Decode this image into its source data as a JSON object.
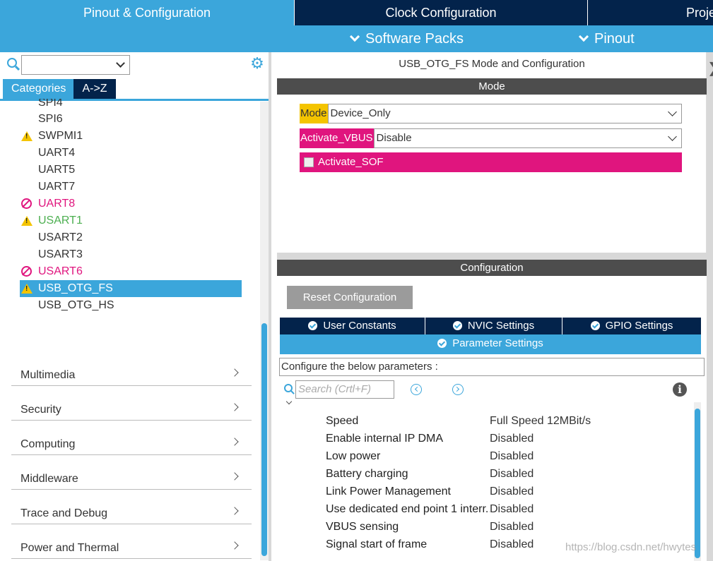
{
  "top_tabs": {
    "pinout_config": "Pinout & Configuration",
    "clock_config": "Clock Configuration",
    "project": "Proje"
  },
  "sub_menu": {
    "software_packs": "Software Packs",
    "pinout": "Pinout"
  },
  "left": {
    "search_value": "",
    "tab_categories": "Categories",
    "tab_az": "A->Z",
    "peripherals": [
      {
        "label": "SPI4",
        "status": "none"
      },
      {
        "label": "SPI6",
        "status": "none"
      },
      {
        "label": "SWPMI1",
        "status": "warning"
      },
      {
        "label": "UART4",
        "status": "none"
      },
      {
        "label": "UART5",
        "status": "none"
      },
      {
        "label": "UART7",
        "status": "none"
      },
      {
        "label": "UART8",
        "status": "disabled"
      },
      {
        "label": "USART1",
        "status": "warning-active"
      },
      {
        "label": "USART2",
        "status": "none"
      },
      {
        "label": "USART3",
        "status": "none"
      },
      {
        "label": "USART6",
        "status": "disabled"
      },
      {
        "label": "USB_OTG_FS",
        "status": "warning-selected"
      },
      {
        "label": "USB_OTG_HS",
        "status": "none"
      }
    ],
    "categories": [
      "Multimedia",
      "Security",
      "Computing",
      "Middleware",
      "Trace and Debug",
      "Power and Thermal"
    ]
  },
  "mode_panel": {
    "title": "USB_OTG_FS Mode and Configuration",
    "section": "Mode",
    "mode_label": "Mode",
    "mode_value": "Device_Only",
    "vbus_label": "Activate_VBUS",
    "vbus_value": "Disable",
    "sof_label": "Activate_SOF"
  },
  "config_panel": {
    "section": "Configuration",
    "reset_button": "Reset Configuration",
    "tabs": [
      "User Constants",
      "NVIC Settings",
      "GPIO Settings"
    ],
    "active_tab": "Parameter Settings",
    "configure_text": "Configure the below parameters :",
    "search_placeholder": "Search (Crtl+F)",
    "params": [
      {
        "name": "Speed",
        "value": "Full Speed 12MBit/s"
      },
      {
        "name": "Enable internal IP DMA",
        "value": "Disabled"
      },
      {
        "name": "Low power",
        "value": "Disabled"
      },
      {
        "name": "Battery charging",
        "value": "Disabled"
      },
      {
        "name": "Link Power Management",
        "value": "Disabled"
      },
      {
        "name": "Use dedicated end point 1 interr...",
        "value": "Disabled"
      },
      {
        "name": "VBUS sensing",
        "value": "Disabled"
      },
      {
        "name": "Signal start of frame",
        "value": "Disabled"
      }
    ]
  },
  "watermark": "https://blog.csdn.net/hwytes",
  "colors": {
    "accent": "#3ba6db",
    "navy": "#03234b",
    "warning": "#f4c400",
    "error": "#e0157e",
    "active_green": "#4caf50"
  }
}
